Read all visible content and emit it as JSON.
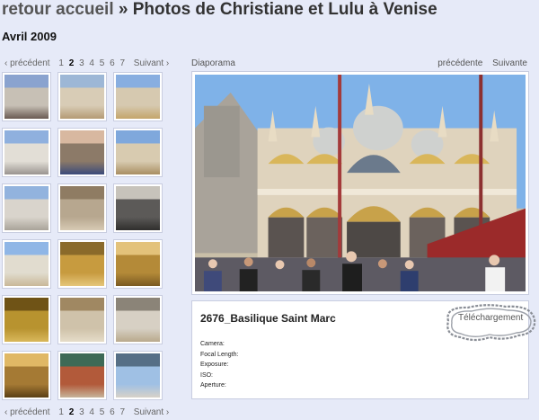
{
  "header": {
    "home": "retour accueil",
    "separator": "»",
    "album": "Photos de Christiane et Lulu à Venise"
  },
  "subtitle": "Avril 2009",
  "pager": {
    "prev": "‹ précédent",
    "pages": [
      "1",
      "2",
      "3",
      "4",
      "5",
      "6",
      "7"
    ],
    "current": "2",
    "next": "Suivant ›"
  },
  "thumbnails": [
    {
      "alt": "people in square"
    },
    {
      "alt": "basilica facade"
    },
    {
      "alt": "basilica facade wide"
    },
    {
      "alt": "palace building"
    },
    {
      "alt": "two women"
    },
    {
      "alt": "basilica domes"
    },
    {
      "alt": "basilica side"
    },
    {
      "alt": "courtyard"
    },
    {
      "alt": "arcade columns"
    },
    {
      "alt": "tower domes"
    },
    {
      "alt": "golden ceiling"
    },
    {
      "alt": "golden vault"
    },
    {
      "alt": "mosaic"
    },
    {
      "alt": "gothic facade"
    },
    {
      "alt": "arched window"
    },
    {
      "alt": "golden dome interior"
    },
    {
      "alt": "marble floor"
    },
    {
      "alt": "lagoon church"
    }
  ],
  "diaporama": "Diaporama",
  "nav": {
    "prev": "précédente",
    "next": "Suivante"
  },
  "photo": {
    "title": "2676_Basilique Saint Marc",
    "download": "Téléchargement",
    "exif": [
      {
        "label": "Camera:"
      },
      {
        "label": "Focal Length:"
      },
      {
        "label": "Exposure:"
      },
      {
        "label": "ISO:"
      },
      {
        "label": "Aperture:"
      }
    ]
  },
  "colors": {
    "background": "#e6eaf8",
    "border": "#c8cde0",
    "sky": "#7fb2e8"
  }
}
